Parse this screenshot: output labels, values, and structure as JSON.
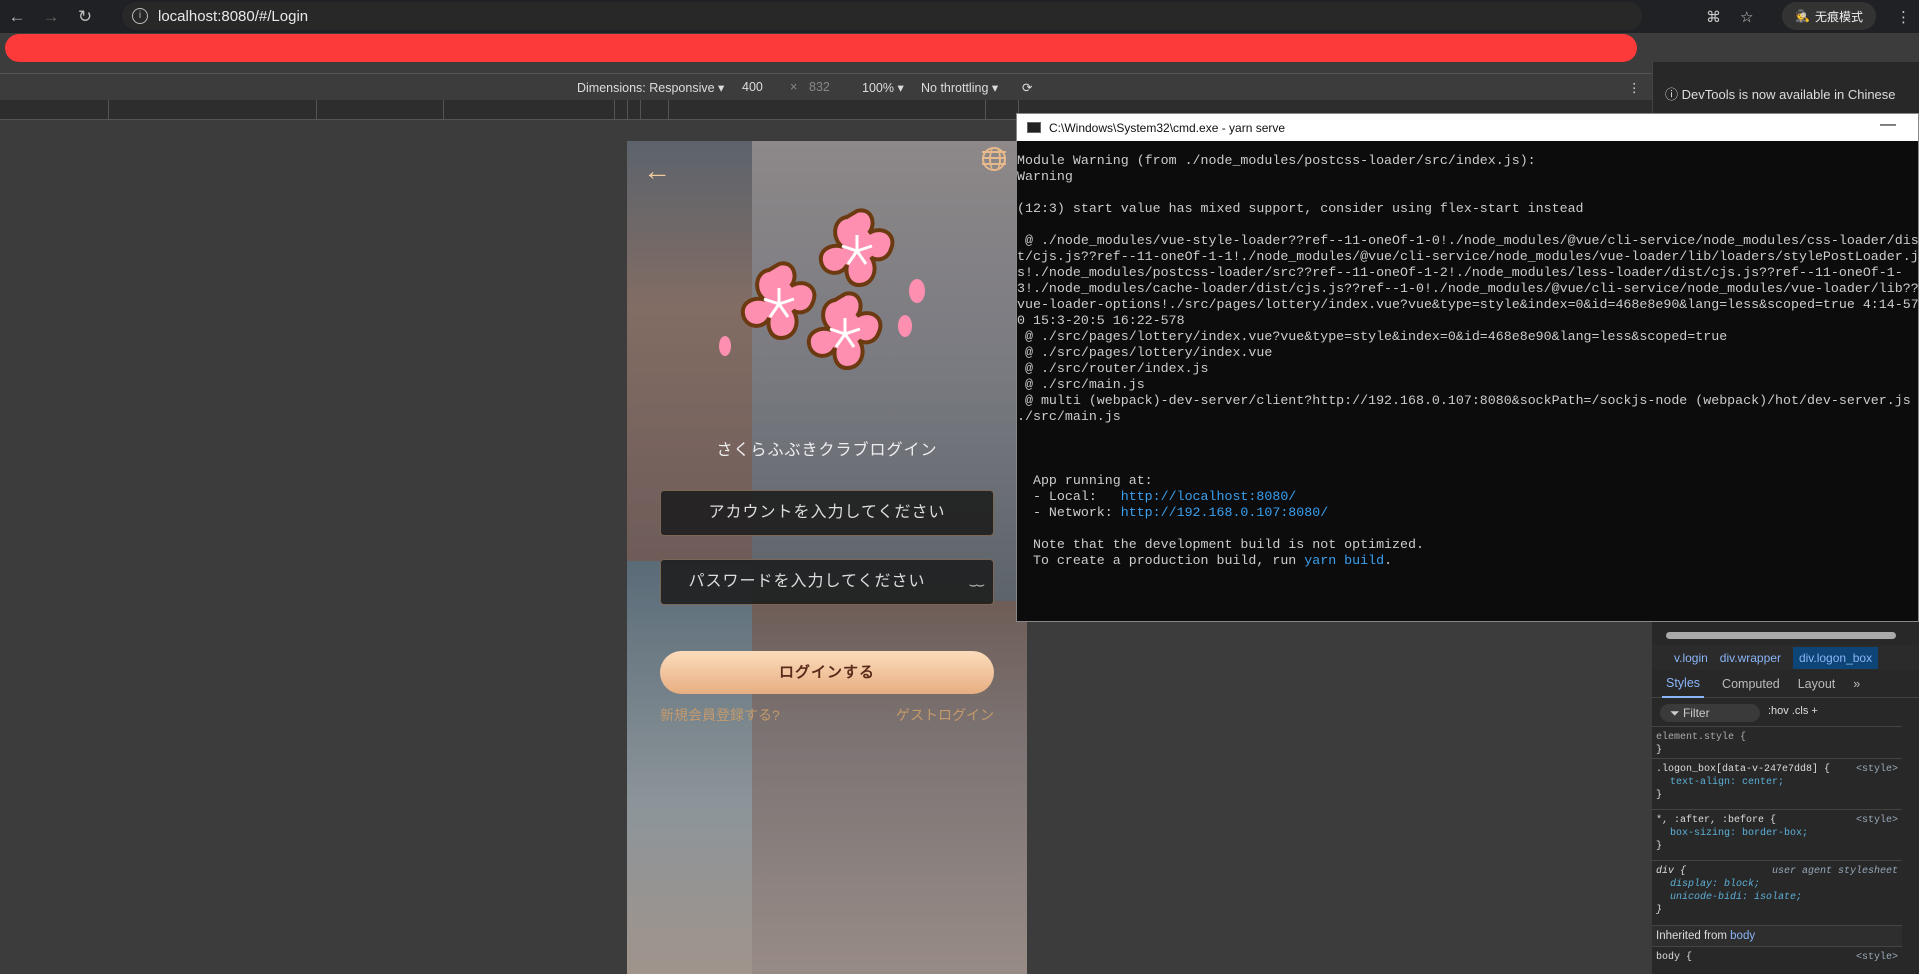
{
  "browser": {
    "url": "localhost:8080/#/Login",
    "incognito_label": "无痕模式"
  },
  "devtools_toolbar": {
    "dimensions": "Dimensions: Responsive ▾",
    "width": "400",
    "x": "×",
    "height": "832",
    "zoom": "100% ▾",
    "throttling": "No throttling ▾"
  },
  "devtools_notice": "DevTools is now available in Chinese",
  "login": {
    "title": "さくらふぶきクラブログイン",
    "account_placeholder": "アカウントを入力してください",
    "password_placeholder": "パスワードを入力してください",
    "login_button": "ログインする",
    "register_link": "新規会員登録する?",
    "guest_link": "ゲストログイン"
  },
  "cmd": {
    "title": "C:\\Windows\\System32\\cmd.exe - yarn  serve",
    "log": "Module Warning (from ./node_modules/postcss-loader/src/index.js):\nWarning\n\n(12:3) start value has mixed support, consider using flex-start instead\n\n @ ./node_modules/vue-style-loader??ref--11-oneOf-1-0!./node_modules/@vue/cli-service/node_modules/css-loader/dist/cjs.js??ref--11-oneOf-1-1!./node_modules/@vue/cli-service/node_modules/vue-loader/lib/loaders/stylePostLoader.js!./node_modules/postcss-loader/src??ref--11-oneOf-1-2!./node_modules/less-loader/dist/cjs.js??ref--11-oneOf-1-3!./node_modules/cache-loader/dist/cjs.js??ref--1-0!./node_modules/@vue/cli-service/node_modules/vue-loader/lib??vue-loader-options!./src/pages/lottery/index.vue?vue&type=style&index=0&id=468e8e90&lang=less&scoped=true 4:14-570 15:3-20:5 16:22-578\n @ ./src/pages/lottery/index.vue?vue&type=style&index=0&id=468e8e90&lang=less&scoped=true\n @ ./src/pages/lottery/index.vue\n @ ./src/router/index.js\n @ ./src/main.js\n @ multi (webpack)-dev-server/client?http://192.168.0.107:8080&sockPath=/sockjs-node (webpack)/hot/dev-server.js ./src/main.js",
    "app_running": "  App running at:",
    "local_label": "  - Local:   ",
    "local_url": "http://localhost:8080/",
    "network_label": "  - Network: ",
    "network_url": "http://192.168.0.107:8080/",
    "note": "  Note that the development build is not optimized.",
    "build_prefix": "  To create a production build, run ",
    "build_cmd": "yarn build",
    "build_suffix": "."
  },
  "styles_panel": {
    "crumbs": [
      "v.login",
      "div.wrapper",
      "div.logon_box"
    ],
    "tabs": [
      "Styles",
      "Computed",
      "Layout",
      "»"
    ],
    "filter": "Filter",
    "tools": ":hov  .cls  +  ",
    "rules": [
      {
        "selector": "element.style {",
        "props": [],
        "close": "}",
        "source": ""
      },
      {
        "selector": ".logon_box[data-v-247e7dd8] {",
        "props": [
          "text-align: center;"
        ],
        "close": "}",
        "source": "<style>"
      },
      {
        "selector": "*, :after, :before {",
        "props": [
          "box-sizing: border-box;"
        ],
        "close": "}",
        "source": "<style>"
      },
      {
        "selector": "div {",
        "props": [
          "display: block;",
          "unicode-bidi: isolate;"
        ],
        "close": "}",
        "source": "user agent stylesheet"
      }
    ],
    "inherited": "Inherited from",
    "inherited_from": "body",
    "body_rule": "body {",
    "body_source": "<style>"
  }
}
